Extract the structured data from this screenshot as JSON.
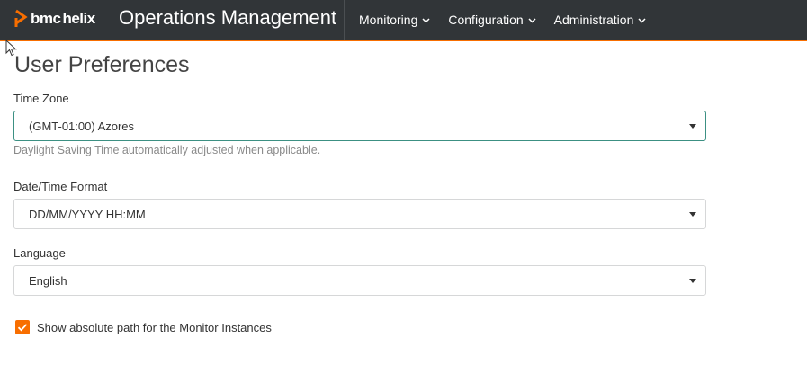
{
  "header": {
    "brand_bmc": "bmc",
    "brand_helix": "helix",
    "app_title": "Operations Management",
    "nav": [
      {
        "label": "Monitoring"
      },
      {
        "label": "Configuration"
      },
      {
        "label": "Administration"
      }
    ]
  },
  "page": {
    "title": "User Preferences"
  },
  "time_zone": {
    "label": "Time Zone",
    "value": "(GMT-01:00) Azores",
    "hint": "Daylight Saving Time automatically adjusted when applicable."
  },
  "datetime_format": {
    "label": "Date/Time Format",
    "value": "DD/MM/YYYY HH:MM"
  },
  "language": {
    "label": "Language",
    "value": "English"
  },
  "absolute_path": {
    "label": "Show absolute path for the Monitor Instances",
    "checked": true
  },
  "colors": {
    "header_bg": "#313538",
    "accent": "#f86e00",
    "focus_border": "#3c9083"
  },
  "icons": [
    "bmc-logo-icon",
    "chevron-down-icon",
    "caret-down-icon",
    "checkmark-icon",
    "mouse-cursor-icon"
  ]
}
